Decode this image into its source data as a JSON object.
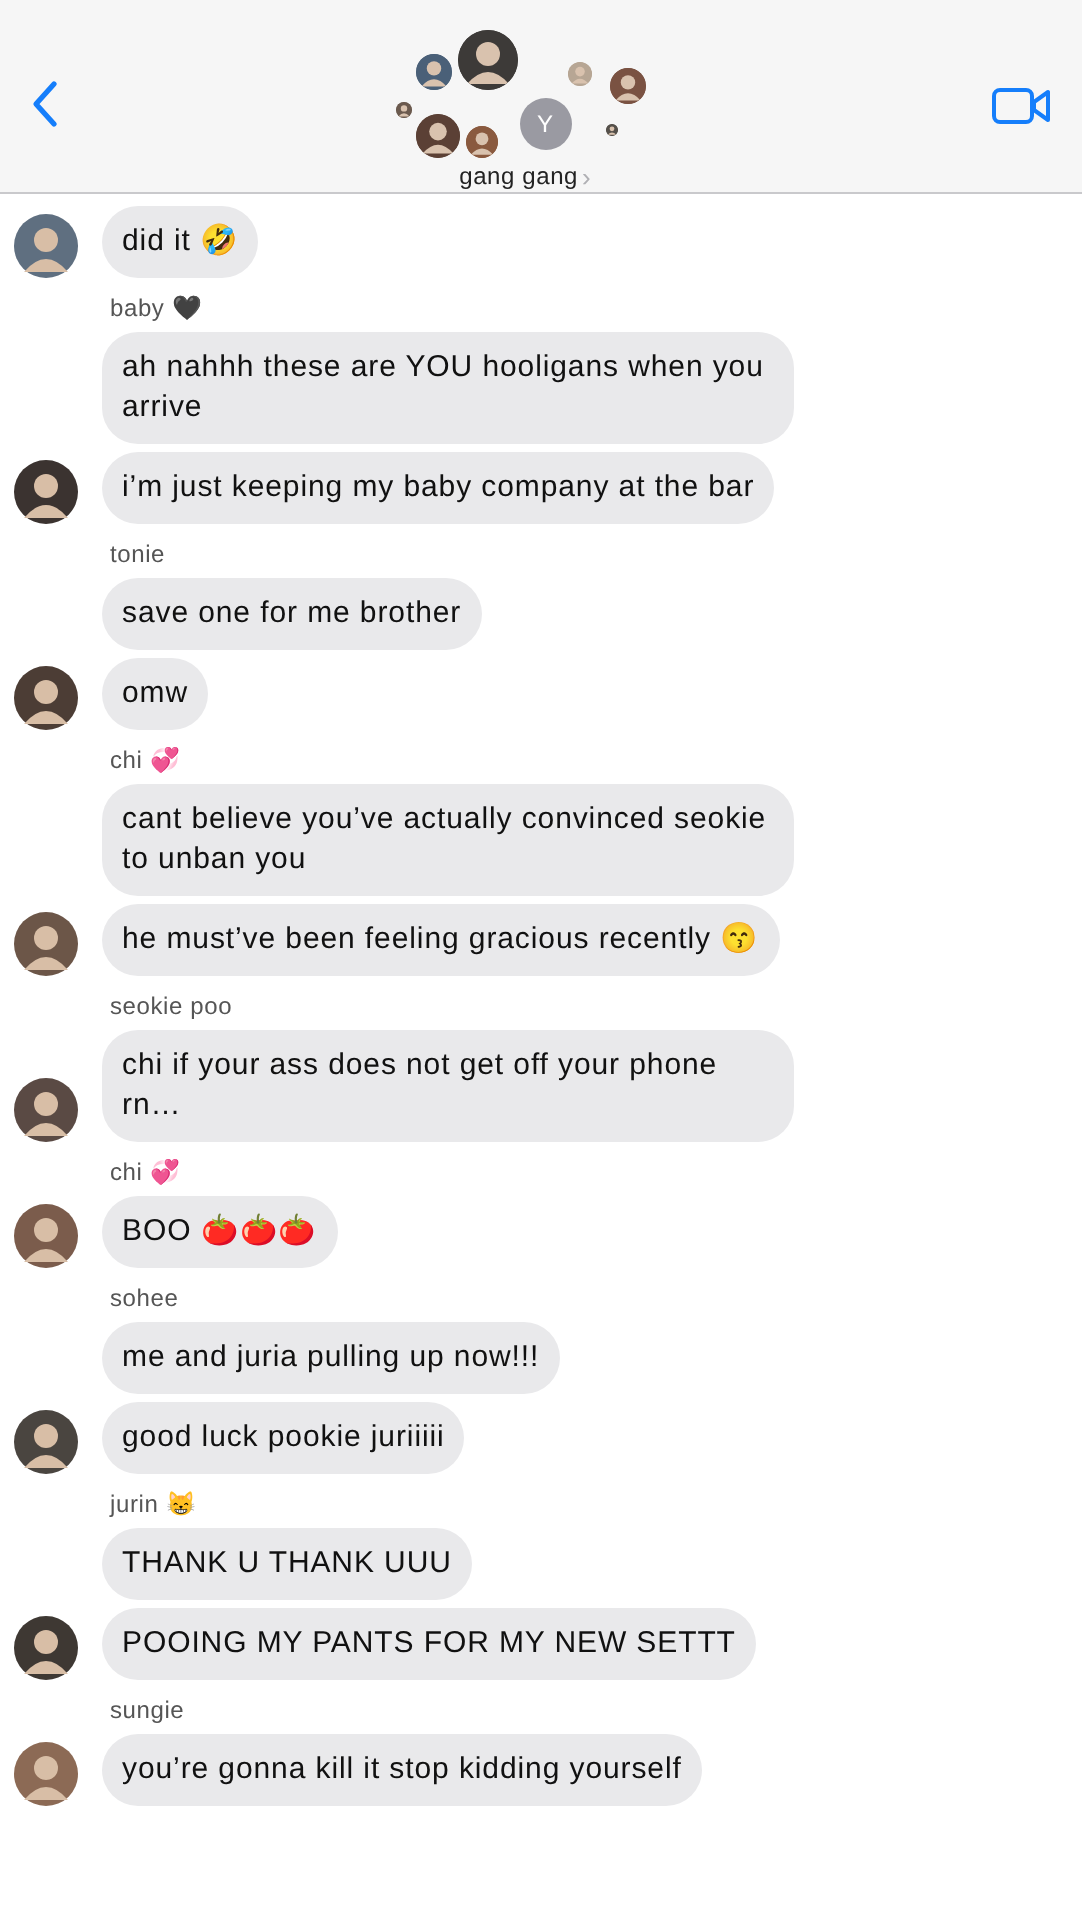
{
  "header": {
    "title": "gang gang",
    "chevron": "›",
    "avatars": [
      {
        "kind": "photo"
      },
      {
        "kind": "photo"
      },
      {
        "kind": "photo"
      },
      {
        "kind": "photo"
      },
      {
        "kind": "photo"
      },
      {
        "kind": "photo"
      },
      {
        "kind": "initial",
        "text": "Y"
      },
      {
        "kind": "photo"
      },
      {
        "kind": "photo"
      }
    ]
  },
  "groups": [
    {
      "messages": [
        "did it 🤣"
      ]
    },
    {
      "sender": "baby 🖤",
      "messages": [
        "ah nahhh these are YOU hooligans when you arrive",
        "i’m just keeping my baby company at the bar"
      ]
    },
    {
      "sender": "tonie",
      "messages": [
        "save one for me brother",
        "omw"
      ]
    },
    {
      "sender": "chi 💞",
      "messages": [
        "cant believe you’ve actually convinced seokie to unban you",
        "he must’ve been feeling gracious recently 😙"
      ]
    },
    {
      "sender": "seokie poo",
      "messages": [
        "chi if your ass does not get off your phone rn…"
      ]
    },
    {
      "sender": "chi 💞",
      "messages": [
        "BOO 🍅🍅🍅"
      ]
    },
    {
      "sender": "sohee",
      "messages": [
        "me and juria pulling up now!!!",
        "good luck pookie juriiiii"
      ]
    },
    {
      "sender": "jurin 😸",
      "messages": [
        "THANK U THANK UUU",
        "POOING MY PANTS FOR MY NEW SETTT"
      ]
    },
    {
      "sender": "sungie",
      "messages": [
        "you’re gonna kill it stop kidding yourself"
      ]
    }
  ]
}
